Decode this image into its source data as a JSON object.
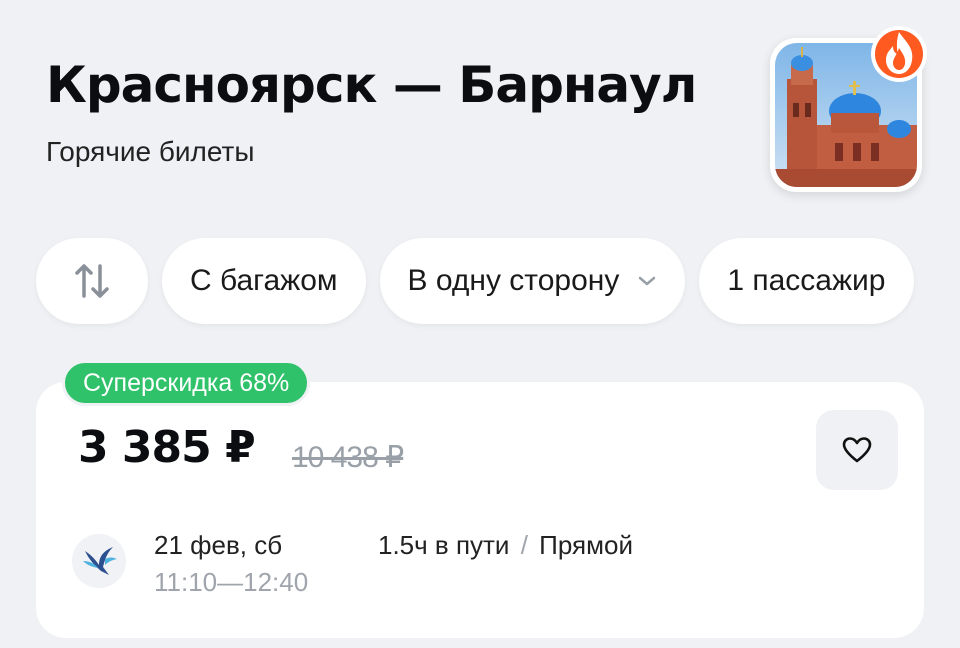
{
  "header": {
    "title": "Красноярск — Барнаул",
    "subtitle": "Горячие билеты",
    "back_icon": "chevron-back-icon",
    "badge_icon": "fire-icon"
  },
  "filters": {
    "swap_icon": "swap-arrows-icon",
    "baggage": "С багажом",
    "trip_type": "В одну сторону",
    "passengers": "1 пассажир"
  },
  "offer": {
    "discount_label": "Суперскидка 68%",
    "price": "3 385 ₽",
    "old_price": "10 438 ₽",
    "favorite_icon": "heart-icon",
    "date": "21 фев, сб",
    "departure": "11:10",
    "arrival": "12:40",
    "time_separator": "—",
    "duration": "1.5ч в пути",
    "separator": "/",
    "route_type": "Прямой"
  },
  "colors": {
    "background": "#eff1f4",
    "accent_green": "#2fc26a",
    "fire_orange": "#ff5a1f",
    "muted": "#9aa0a8"
  }
}
